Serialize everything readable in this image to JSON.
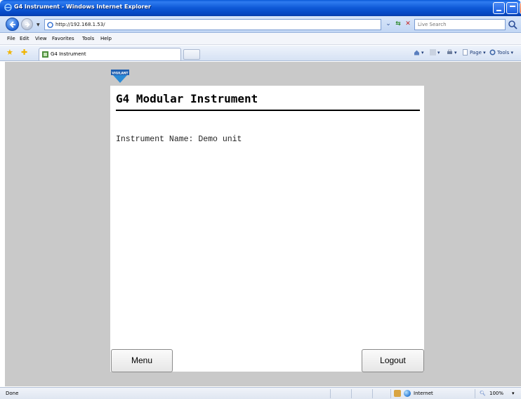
{
  "window": {
    "title": "G4 Instrument - Windows Internet Explorer"
  },
  "address_bar": {
    "url": "http://192.168.1.53/"
  },
  "search": {
    "placeholder": "Live Search"
  },
  "menu_bar": {
    "items": [
      "File",
      "Edit",
      "View",
      "Favorites",
      "Tools",
      "Help"
    ]
  },
  "tab": {
    "label": "G4 Instrument"
  },
  "command_bar": {
    "page_label": "Page",
    "tools_label": "Tools"
  },
  "page": {
    "logo_text": "VIGILANT",
    "title": "G4 Modular Instrument",
    "instrument_name_line": "Instrument Name: Demo unit",
    "menu_button": "Menu",
    "logout_button": "Logout"
  },
  "status_bar": {
    "status": "Done",
    "zone": "Internet",
    "zoom": "100%"
  },
  "colors": {
    "titlebar_blue": "#0d58d6",
    "page_background": "#c9c9c9",
    "panel_background": "#ffffff",
    "logo_blue": "#2a8ad6"
  }
}
